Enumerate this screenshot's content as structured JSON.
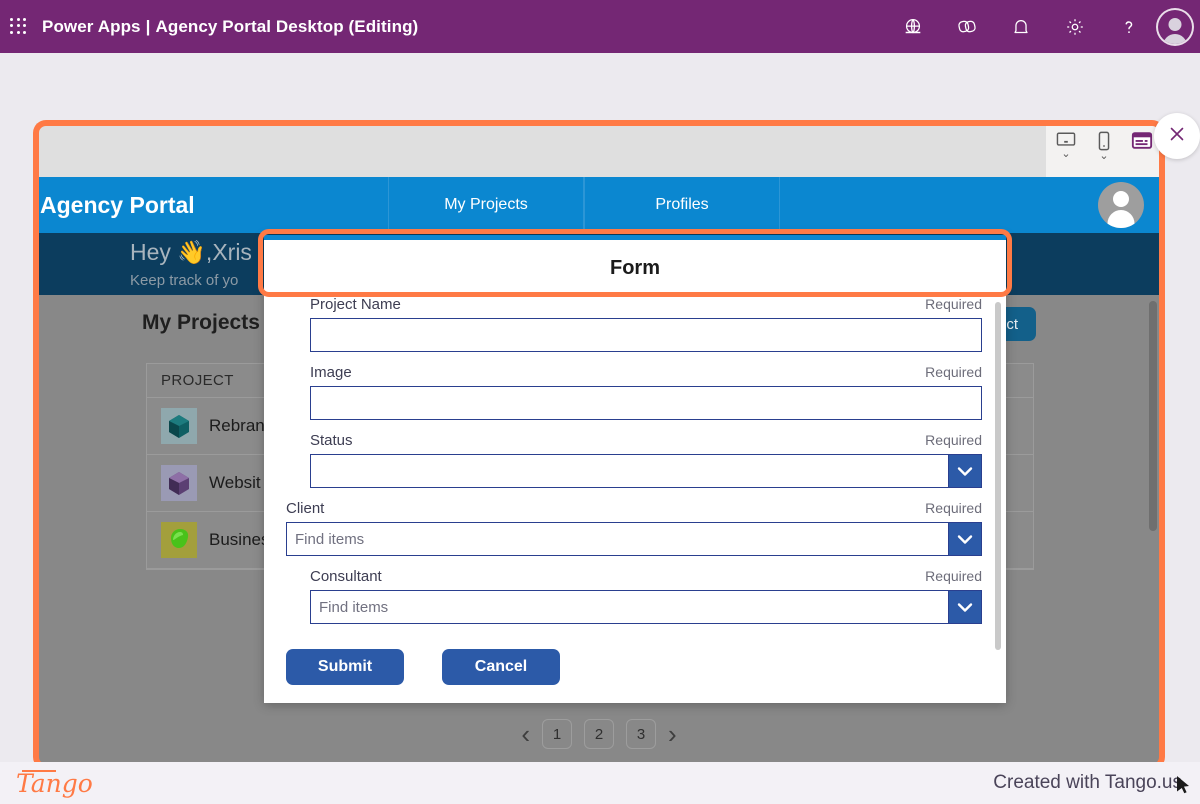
{
  "topbar": {
    "waffle_icon": "waffle-grid-icon",
    "product": "Power Apps",
    "separator": "|",
    "app_name": "Agency Portal Desktop (Editing)",
    "icons": [
      {
        "name": "globe-icon",
        "label": "Environment"
      },
      {
        "name": "layers-icon",
        "label": "Apps"
      },
      {
        "name": "bell-icon",
        "label": "Notifications"
      },
      {
        "name": "gear-icon",
        "label": "Settings"
      },
      {
        "name": "help-icon",
        "label": "?"
      }
    ],
    "avatar": "user-avatar"
  },
  "device_bar": {
    "desktop_icon": "desktop-monitor-icon",
    "mobile_icon": "mobile-phone-icon",
    "form_icon": "form-card-icon",
    "chevron": "⌄"
  },
  "portal": {
    "brand": "Agency Portal",
    "tabs": [
      {
        "label": "My Projects"
      },
      {
        "label": "Profiles"
      }
    ],
    "avatar": "portal-user-avatar"
  },
  "hero": {
    "greeting": "Hey  👋,Xris",
    "subtitle": "Keep track of yo"
  },
  "main": {
    "heading": "My Projects",
    "new_project_button": "ject",
    "table": {
      "header": "PROJECT",
      "rows": [
        {
          "label": "Rebran",
          "thumb": "teal-polyhedron-thumb"
        },
        {
          "label": "Websit",
          "thumb": "purple-polyhedron-thumb"
        },
        {
          "label": "Busines",
          "thumb": "green-blob-thumb"
        }
      ]
    },
    "pagination": {
      "prev": "‹",
      "pages": [
        "1",
        "2",
        "3"
      ],
      "next": "›"
    }
  },
  "modal": {
    "title": "Form",
    "fields": [
      {
        "label": "Project Name",
        "required": "Required",
        "type": "text",
        "value": "",
        "placeholder": ""
      },
      {
        "label": "Image",
        "required": "Required",
        "type": "text",
        "value": "",
        "placeholder": ""
      },
      {
        "label": "Status",
        "required": "Required",
        "type": "dropdown",
        "value": "",
        "placeholder": ""
      },
      {
        "label": "Client",
        "required": "Required",
        "type": "combobox",
        "value": "",
        "placeholder": "Find items"
      },
      {
        "label": "Consultant",
        "required": "Required",
        "type": "combobox",
        "value": "",
        "placeholder": "Find items"
      }
    ],
    "submit_label": "Submit",
    "cancel_label": "Cancel",
    "chevron_icon": "chevron-down-icon"
  },
  "close_button": {
    "icon": "close-x-icon"
  },
  "footer": {
    "logo_text": "Tango",
    "credit": "Created with Tango.us"
  },
  "colors": {
    "brand_purple": "#742774",
    "portal_blue": "#0b87d0",
    "hero_navy": "#0c3d5e",
    "highlight_orange": "#ff7a45",
    "button_blue": "#2c5aa8",
    "new_project_blue": "#13608a"
  }
}
